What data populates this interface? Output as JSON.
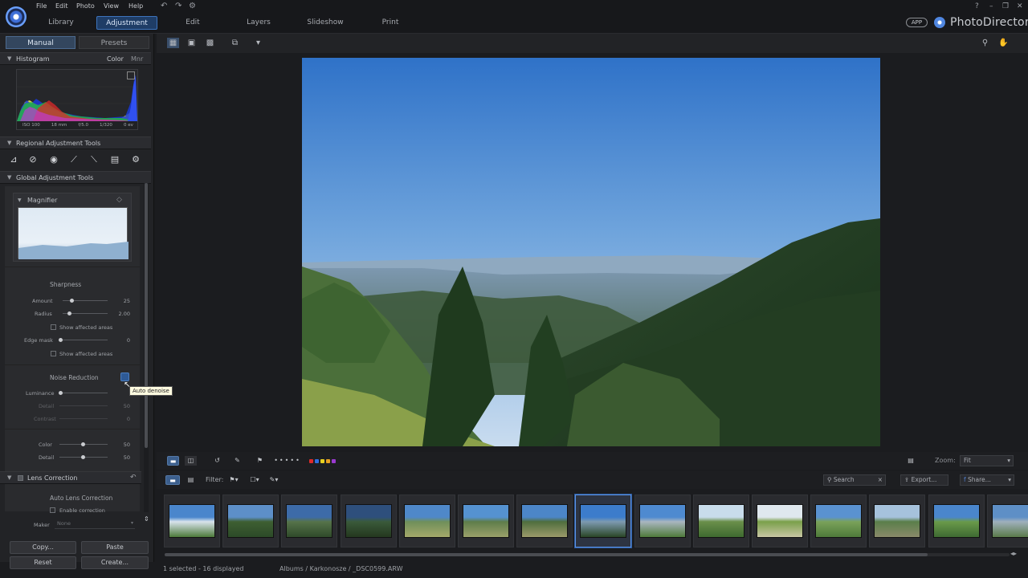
{
  "menu": [
    "File",
    "Edit",
    "Photo",
    "View",
    "Help"
  ],
  "mode_tabs": [
    "Library",
    "Adjustment",
    "Edit",
    "Layers",
    "Slideshow",
    "Print"
  ],
  "active_mode": "Adjustment",
  "brand": {
    "app_badge": "APP",
    "name": "PhotoDirector"
  },
  "window_controls": [
    "?",
    "–",
    "❐",
    "✕"
  ],
  "left_panel": {
    "tabs": [
      "Manual",
      "Presets"
    ],
    "histogram": {
      "title": "Histogram",
      "modes": [
        "Color",
        "Mnr"
      ],
      "exif": [
        "ISO 100",
        "18 mm",
        "f/5.0",
        "1/320",
        "0 ev"
      ]
    },
    "regional_title": "Regional Adjustment Tools",
    "global_title": "Global Adjustment Tools",
    "magnifier_title": "Magnifier",
    "sharpness": {
      "title": "Sharpness",
      "amount_label": "Amount",
      "amount_value": "25",
      "radius_label": "Radius",
      "radius_value": "2.00",
      "show_affected_1": "Show affected areas",
      "edge_mask_label": "Edge mask",
      "edge_mask_value": "0",
      "show_affected_2": "Show affected areas"
    },
    "noise": {
      "title": "Noise Reduction",
      "luminance_label": "Luminance",
      "detail_label": "Detail",
      "detail_value": "50",
      "contrast_label": "Contrast",
      "contrast_value": "0",
      "color_label": "Color",
      "color_value": "50",
      "color_detail_label": "Detail",
      "color_detail_value": "50"
    },
    "tooltip": "Auto denoise",
    "lens": {
      "title": "Lens Correction",
      "auto_title": "Auto Lens Correction",
      "enable_label": "Enable correction",
      "maker_label": "Maker",
      "maker_value": "None"
    },
    "buttons": [
      "Copy...",
      "Paste",
      "Reset",
      "Create..."
    ]
  },
  "filter": {
    "label": "Filter:"
  },
  "search": {
    "placeholder": "Search"
  },
  "actions": {
    "export": "Export...",
    "share": "Share..."
  },
  "zoom": {
    "label": "Zoom:",
    "value": "Fit"
  },
  "colors": {
    "accent": "#3d74bd",
    "selection": "#5a93e6"
  },
  "label_colors": [
    "#e02a2a",
    "#2f6fe0",
    "#e8d020",
    "#e8a020",
    "#9a3ad0"
  ],
  "status": {
    "selection": "1 selected - 16 displayed",
    "path": "Albums / Karkonosze / _DSC0599.ARW"
  },
  "thumbnail_count": 15,
  "selected_thumbnail": 7
}
